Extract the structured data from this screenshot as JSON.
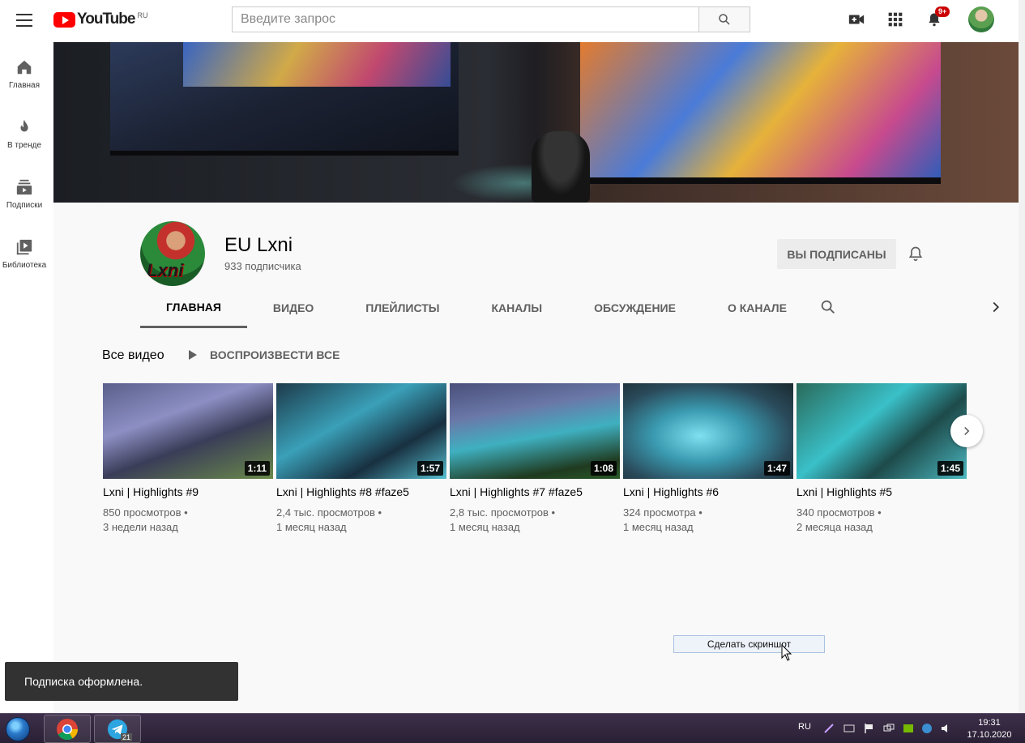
{
  "header": {
    "logo_text": "YouTube",
    "logo_region": "RU",
    "search_placeholder": "Введите запрос",
    "notifications_badge": "9+"
  },
  "sidebar": {
    "items": [
      {
        "label": "Главная",
        "icon": "home-icon"
      },
      {
        "label": "В тренде",
        "icon": "trending-icon"
      },
      {
        "label": "Подписки",
        "icon": "subscriptions-icon"
      },
      {
        "label": "Библиотека",
        "icon": "library-icon"
      }
    ]
  },
  "channel": {
    "name": "EU Lxni",
    "subscribers": "933 подписчика",
    "avatar_text": "Lxni",
    "subscribe_label": "ВЫ ПОДПИСАНЫ"
  },
  "tabs": [
    {
      "label": "ГЛАВНАЯ",
      "active": true
    },
    {
      "label": "ВИДЕО",
      "active": false
    },
    {
      "label": "ПЛЕЙЛИСТЫ",
      "active": false
    },
    {
      "label": "КАНАЛЫ",
      "active": false
    },
    {
      "label": "ОБСУЖДЕНИЕ",
      "active": false
    },
    {
      "label": "О КАНАЛЕ",
      "active": false
    }
  ],
  "shelf": {
    "title": "Все видео",
    "play_all": "ВОСПРОИЗВЕСТИ ВСЕ"
  },
  "videos": [
    {
      "title": "Lxni | Highlights #9",
      "duration": "1:11",
      "views": "850 просмотров",
      "age": "3 недели назад"
    },
    {
      "title": "Lxni | Highlights #8 #faze5",
      "duration": "1:57",
      "views": "2,4 тыс. просмотров",
      "age": "1 месяц назад"
    },
    {
      "title": "Lxni | Highlights #7 #faze5",
      "duration": "1:08",
      "views": "2,8 тыс. просмотров",
      "age": "1 месяц назад"
    },
    {
      "title": "Lxni | Highlights #6",
      "duration": "1:47",
      "views": "324 просмотра",
      "age": "1 месяц назад"
    },
    {
      "title": "Lxni | Highlights #5",
      "duration": "1:45",
      "views": "340 просмотров",
      "age": "2 месяца назад"
    }
  ],
  "meta_separator": " •",
  "screenshot_button": "Сделать скриншот",
  "toast": "Подписка оформлена.",
  "taskbar": {
    "telegram_badge": "21",
    "language": "RU",
    "time": "19:31",
    "date": "17.10.2020"
  },
  "colors": {
    "brand_red": "#ff0000",
    "badge_red": "#cc0000",
    "toast_bg": "#323232"
  }
}
